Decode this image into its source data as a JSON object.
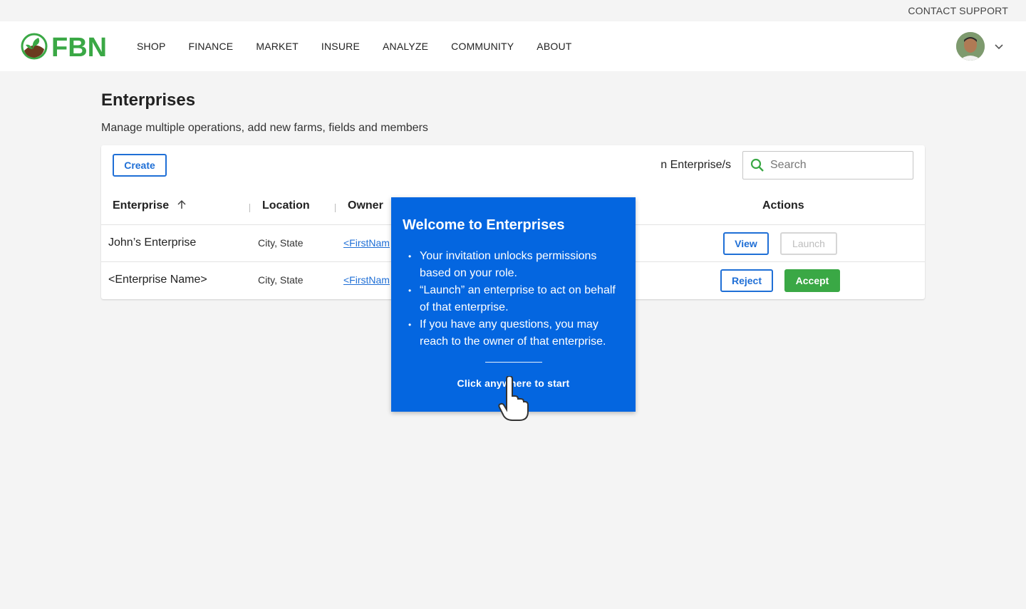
{
  "topbar": {
    "contact_support": "CONTACT SUPPORT"
  },
  "nav": {
    "logo_text": "FBN",
    "items": [
      "SHOP",
      "FINANCE",
      "MARKET",
      "INSURE",
      "ANALYZE",
      "COMMUNITY",
      "ABOUT"
    ]
  },
  "page": {
    "title": "Enterprises",
    "subtitle": "Manage multiple operations, add new farms, fields and members"
  },
  "toolbar": {
    "create_label": "Create",
    "count_text": "n Enterprise/s",
    "search_placeholder": "Search"
  },
  "table": {
    "headers": {
      "enterprise": "Enterprise",
      "location": "Location",
      "owner": "Owner",
      "actions": "Actions"
    },
    "rows": [
      {
        "name": "John’s Enterprise",
        "location": "City, State",
        "owner": "<FirstNam",
        "actions": [
          "View",
          "Launch"
        ]
      },
      {
        "name": "<Enterprise Name>",
        "location": "City, State",
        "owner": "<FirstNam",
        "actions": [
          "Reject",
          "Accept"
        ]
      }
    ]
  },
  "popover": {
    "title": "Welcome to Enterprises",
    "bullets": [
      "Your invitation unlocks permissions based on your role.",
      "“Launch” an enterprise to act on behalf of that enterprise.",
      "If you have any questions, you may reach to the owner of that enterprise."
    ],
    "cta": "Click anywhere to start"
  },
  "colors": {
    "brand_green": "#3aa845",
    "primary_blue": "#1f6fd6",
    "popover_blue": "#0466e0"
  }
}
